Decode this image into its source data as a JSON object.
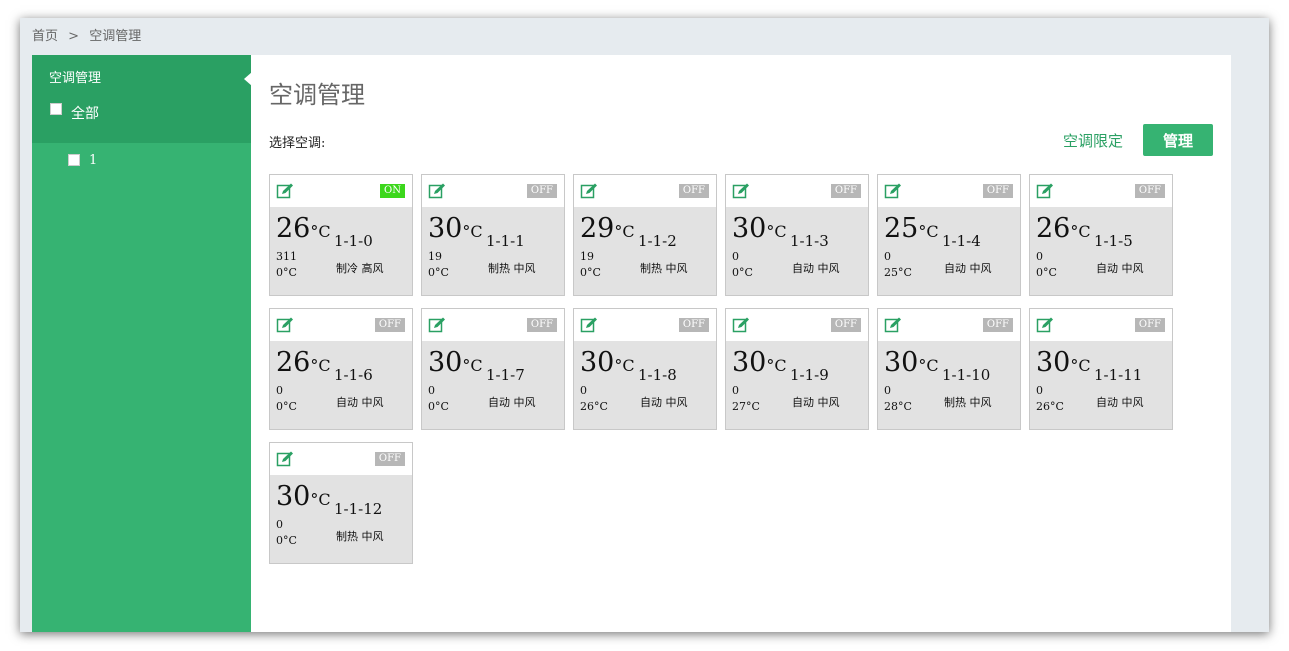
{
  "breadcrumb": {
    "home": "首页",
    "sep": ">",
    "current": "空调管理"
  },
  "sidebar": {
    "title": "空调管理",
    "all_label": "全部",
    "items": [
      {
        "label": "1"
      }
    ]
  },
  "main": {
    "title": "空调管理",
    "select_label": "选择空调:",
    "limit_link": "空调限定",
    "manage_button": "管理"
  },
  "colors": {
    "accent": "#36b372",
    "accent_dark": "#2aa063",
    "on": "#3cd71c",
    "off": "#b7b7b7"
  },
  "units": {
    "temp": "°C"
  },
  "ac_units": [
    {
      "name": "1-1-0",
      "set_temp": "26",
      "status": "ON",
      "value": "311",
      "room_temp": "0",
      "mode": "制冷",
      "fan": "高风"
    },
    {
      "name": "1-1-1",
      "set_temp": "30",
      "status": "OFF",
      "value": "19",
      "room_temp": "0",
      "mode": "制热",
      "fan": "中风"
    },
    {
      "name": "1-1-2",
      "set_temp": "29",
      "status": "OFF",
      "value": "19",
      "room_temp": "0",
      "mode": "制热",
      "fan": "中风"
    },
    {
      "name": "1-1-3",
      "set_temp": "30",
      "status": "OFF",
      "value": "0",
      "room_temp": "0",
      "mode": "自动",
      "fan": "中风"
    },
    {
      "name": "1-1-4",
      "set_temp": "25",
      "status": "OFF",
      "value": "0",
      "room_temp": "25",
      "mode": "自动",
      "fan": "中风"
    },
    {
      "name": "1-1-5",
      "set_temp": "26",
      "status": "OFF",
      "value": "0",
      "room_temp": "0",
      "mode": "自动",
      "fan": "中风"
    },
    {
      "name": "1-1-6",
      "set_temp": "26",
      "status": "OFF",
      "value": "0",
      "room_temp": "0",
      "mode": "自动",
      "fan": "中风"
    },
    {
      "name": "1-1-7",
      "set_temp": "30",
      "status": "OFF",
      "value": "0",
      "room_temp": "0",
      "mode": "自动",
      "fan": "中风"
    },
    {
      "name": "1-1-8",
      "set_temp": "30",
      "status": "OFF",
      "value": "0",
      "room_temp": "26",
      "mode": "自动",
      "fan": "中风"
    },
    {
      "name": "1-1-9",
      "set_temp": "30",
      "status": "OFF",
      "value": "0",
      "room_temp": "27",
      "mode": "自动",
      "fan": "中风"
    },
    {
      "name": "1-1-10",
      "set_temp": "30",
      "status": "OFF",
      "value": "0",
      "room_temp": "28",
      "mode": "制热",
      "fan": "中风"
    },
    {
      "name": "1-1-11",
      "set_temp": "30",
      "status": "OFF",
      "value": "0",
      "room_temp": "26",
      "mode": "自动",
      "fan": "中风"
    },
    {
      "name": "1-1-12",
      "set_temp": "30",
      "status": "OFF",
      "value": "0",
      "room_temp": "0",
      "mode": "制热",
      "fan": "中风"
    }
  ]
}
